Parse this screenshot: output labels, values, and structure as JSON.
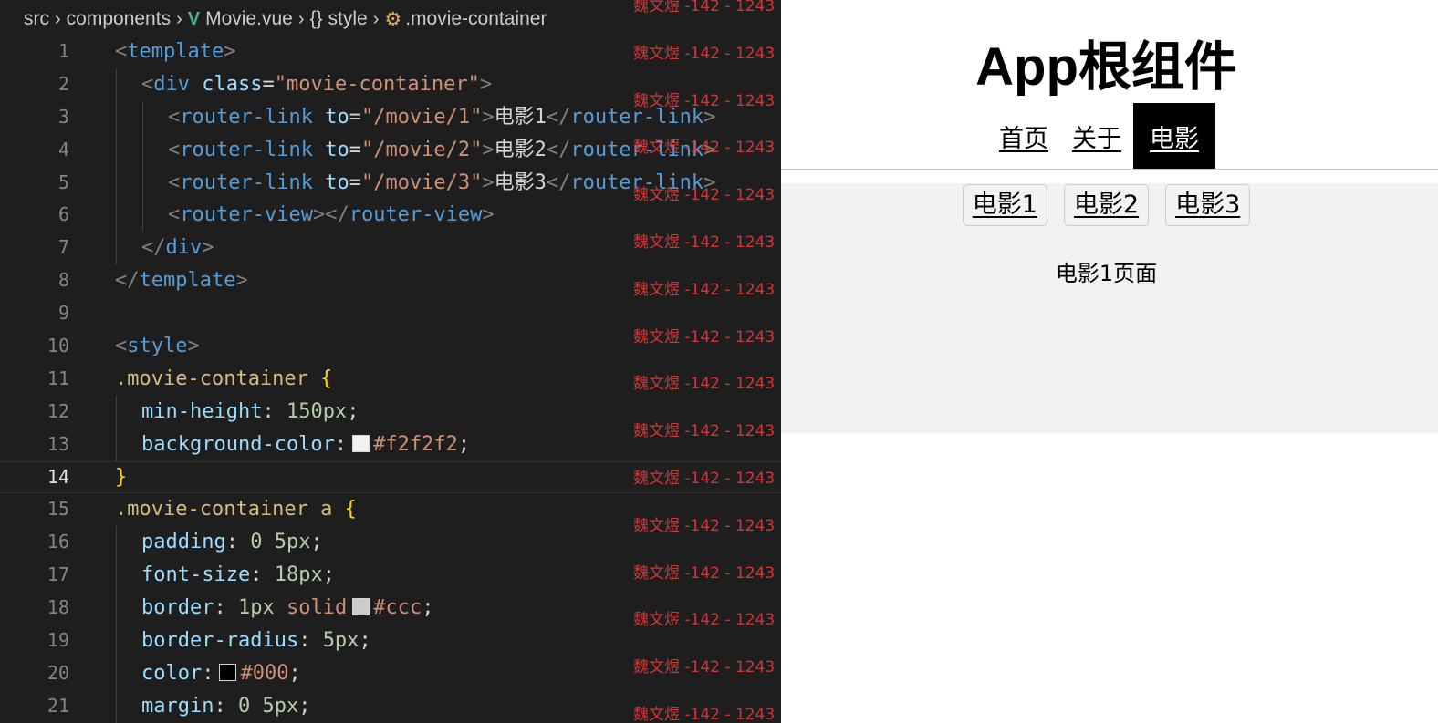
{
  "breadcrumb": {
    "items": [
      "src",
      "components",
      "Movie.vue",
      "style",
      ".movie-container"
    ],
    "vue_icon": "V",
    "braces_icon": "{}",
    "selector_icon": "⚙"
  },
  "code_lines": [
    {
      "n": "1",
      "indent": 0,
      "tokens": [
        [
          "pun",
          "<"
        ],
        [
          "tag",
          "template"
        ],
        [
          "pun",
          ">"
        ]
      ]
    },
    {
      "n": "2",
      "indent": 1,
      "tokens": [
        [
          "pun",
          "<"
        ],
        [
          "tag",
          "div"
        ],
        [
          "txt",
          " "
        ],
        [
          "attr",
          "class"
        ],
        [
          "txt",
          "="
        ],
        [
          "str",
          "\"movie-container\""
        ],
        [
          "pun",
          ">"
        ]
      ]
    },
    {
      "n": "3",
      "indent": 2,
      "tokens": [
        [
          "pun",
          "<"
        ],
        [
          "tag",
          "router-link"
        ],
        [
          "txt",
          " "
        ],
        [
          "attr",
          "to"
        ],
        [
          "txt",
          "="
        ],
        [
          "str",
          "\"/movie/1\""
        ],
        [
          "pun",
          ">"
        ],
        [
          "txt",
          "电影1"
        ],
        [
          "pun",
          "</"
        ],
        [
          "tag",
          "router-link"
        ],
        [
          "pun",
          ">"
        ]
      ]
    },
    {
      "n": "4",
      "indent": 2,
      "tokens": [
        [
          "pun",
          "<"
        ],
        [
          "tag",
          "router-link"
        ],
        [
          "txt",
          " "
        ],
        [
          "attr",
          "to"
        ],
        [
          "txt",
          "="
        ],
        [
          "str",
          "\"/movie/2\""
        ],
        [
          "pun",
          ">"
        ],
        [
          "txt",
          "电影2"
        ],
        [
          "pun",
          "</"
        ],
        [
          "tag",
          "router-link"
        ],
        [
          "pun",
          ">"
        ]
      ]
    },
    {
      "n": "5",
      "indent": 2,
      "tokens": [
        [
          "pun",
          "<"
        ],
        [
          "tag",
          "router-link"
        ],
        [
          "txt",
          " "
        ],
        [
          "attr",
          "to"
        ],
        [
          "txt",
          "="
        ],
        [
          "str",
          "\"/movie/3\""
        ],
        [
          "pun",
          ">"
        ],
        [
          "txt",
          "电影3"
        ],
        [
          "pun",
          "</"
        ],
        [
          "tag",
          "router-link"
        ],
        [
          "pun",
          ">"
        ]
      ]
    },
    {
      "n": "6",
      "indent": 2,
      "tokens": [
        [
          "pun",
          "<"
        ],
        [
          "tag",
          "router-view"
        ],
        [
          "pun",
          "></"
        ],
        [
          "tag",
          "router-view"
        ],
        [
          "pun",
          ">"
        ]
      ]
    },
    {
      "n": "7",
      "indent": 1,
      "tokens": [
        [
          "pun",
          "</"
        ],
        [
          "tag",
          "div"
        ],
        [
          "pun",
          ">"
        ]
      ]
    },
    {
      "n": "8",
      "indent": 0,
      "tokens": [
        [
          "pun",
          "</"
        ],
        [
          "tag",
          "template"
        ],
        [
          "pun",
          ">"
        ]
      ]
    },
    {
      "n": "9",
      "indent": 0,
      "tokens": []
    },
    {
      "n": "10",
      "indent": 0,
      "tokens": [
        [
          "pun",
          "<"
        ],
        [
          "tag",
          "style"
        ],
        [
          "pun",
          ">"
        ]
      ]
    },
    {
      "n": "11",
      "indent": 0,
      "tokens": [
        [
          "sel",
          ".movie-container"
        ],
        [
          "txt",
          " "
        ],
        [
          "brace",
          "{"
        ]
      ]
    },
    {
      "n": "12",
      "indent": 1,
      "tokens": [
        [
          "prop",
          "min-height"
        ],
        [
          "txt",
          ": "
        ],
        [
          "num",
          "150px"
        ],
        [
          "txt",
          ";"
        ]
      ]
    },
    {
      "n": "13",
      "indent": 1,
      "tokens": [
        [
          "prop",
          "background-color"
        ],
        [
          "txt",
          ":"
        ],
        [
          "swatch",
          "#f2f2f2"
        ],
        [
          "val",
          "#f2f2f2"
        ],
        [
          "txt",
          ";"
        ]
      ]
    },
    {
      "n": "14",
      "indent": 0,
      "tokens": [
        [
          "brace",
          "}"
        ]
      ],
      "active": true
    },
    {
      "n": "15",
      "indent": 0,
      "tokens": [
        [
          "sel",
          ".movie-container a"
        ],
        [
          "txt",
          " "
        ],
        [
          "brace",
          "{"
        ]
      ]
    },
    {
      "n": "16",
      "indent": 1,
      "tokens": [
        [
          "prop",
          "padding"
        ],
        [
          "txt",
          ": "
        ],
        [
          "num",
          "0 5px"
        ],
        [
          "txt",
          ";"
        ]
      ]
    },
    {
      "n": "17",
      "indent": 1,
      "tokens": [
        [
          "prop",
          "font-size"
        ],
        [
          "txt",
          ": "
        ],
        [
          "num",
          "18px"
        ],
        [
          "txt",
          ";"
        ]
      ]
    },
    {
      "n": "18",
      "indent": 1,
      "tokens": [
        [
          "prop",
          "border"
        ],
        [
          "txt",
          ": "
        ],
        [
          "num",
          "1px"
        ],
        [
          "txt",
          " "
        ],
        [
          "val",
          "solid"
        ],
        [
          "swatch",
          "#cccccc"
        ],
        [
          "val",
          "#ccc"
        ],
        [
          "txt",
          ";"
        ]
      ]
    },
    {
      "n": "19",
      "indent": 1,
      "tokens": [
        [
          "prop",
          "border-radius"
        ],
        [
          "txt",
          ": "
        ],
        [
          "num",
          "5px"
        ],
        [
          "txt",
          ";"
        ]
      ]
    },
    {
      "n": "20",
      "indent": 1,
      "tokens": [
        [
          "prop",
          "color"
        ],
        [
          "txt",
          ":"
        ],
        [
          "swatch",
          "#000000"
        ],
        [
          "val",
          "#000"
        ],
        [
          "txt",
          ";"
        ]
      ]
    },
    {
      "n": "21",
      "indent": 1,
      "tokens": [
        [
          "prop",
          "margin"
        ],
        [
          "txt",
          ": "
        ],
        [
          "num",
          "0 5px"
        ],
        [
          "txt",
          ";"
        ]
      ]
    }
  ],
  "watermark_text": "魏文煜 -142 - 1243",
  "watermark_count": 16,
  "browser": {
    "title": "App根组件",
    "nav": [
      {
        "label": "首页",
        "active": false
      },
      {
        "label": "关于",
        "active": false
      },
      {
        "label": "电影",
        "active": true
      }
    ],
    "movie_links": [
      "电影1",
      "电影2",
      "电影3"
    ],
    "page_text": "电影1页面"
  },
  "colors": {
    "editor_bg": "#1e1e1e",
    "movie_container_bg": "#f2f2f2",
    "link_border": "#cccccc",
    "active_nav_bg": "#000000",
    "watermark": "#e03a3a"
  }
}
